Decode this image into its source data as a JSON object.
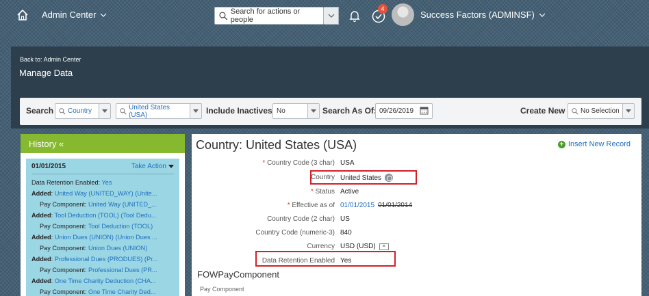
{
  "shell": {
    "app_title": "Admin Center",
    "search_placeholder": "Search for actions or people",
    "todo_count": "4",
    "user_name": "Success Factors (ADMINSF)"
  },
  "header": {
    "back_link": "Back to: Admin Center",
    "title": "Manage Data"
  },
  "filters": {
    "search_label": "Search",
    "object_type": "Country",
    "object_value": "United States (USA)",
    "include_inactives_label": "Include Inactives:",
    "include_inactives_value": "No",
    "search_as_of_label": "Search As Of:",
    "search_as_of_value": "09/26/2019",
    "create_new_label": "Create New",
    "create_new_value": "No Selection"
  },
  "history": {
    "title": "History «",
    "date": "01/01/2015",
    "take_action": "Take Action",
    "lines": [
      {
        "prefix": "Data Retention Enabled: ",
        "link": "Yes",
        "bold": false,
        "indent": false
      },
      {
        "prefix": "Added",
        "sep": ": ",
        "link": "United Way (UNITED_WAY) (Unite...",
        "bold": true,
        "indent": false
      },
      {
        "prefix": "Pay Component: ",
        "link": "United Way (UNITED_...",
        "bold": false,
        "indent": true
      },
      {
        "prefix": "Added",
        "sep": ": ",
        "link": "Tool Deduction (TOOL) (Tool Dedu...",
        "bold": true,
        "indent": false
      },
      {
        "prefix": "Pay Component: ",
        "link": "Tool Deduction (TOOL)",
        "bold": false,
        "indent": true
      },
      {
        "prefix": "Added",
        "sep": ": ",
        "link": "Union Dues (UNION) (Union Dues ...",
        "bold": true,
        "indent": false
      },
      {
        "prefix": "Pay Component: ",
        "link": "Union Dues (UNION)",
        "bold": false,
        "indent": true
      },
      {
        "prefix": "Added",
        "sep": ": ",
        "link": "Professional Dues (PRODUES) (Pr...",
        "bold": true,
        "indent": false
      },
      {
        "prefix": "Pay Component: ",
        "link": "Professional Dues (PR...",
        "bold": false,
        "indent": true
      },
      {
        "prefix": "Added",
        "sep": ": ",
        "link": "One Time Charity Deduction (CHA...",
        "bold": true,
        "indent": false
      },
      {
        "prefix": "Pay Component: ",
        "link": "One Time Charity Ded...",
        "bold": false,
        "indent": true
      }
    ]
  },
  "record": {
    "title": "Country: United States (USA)",
    "insert_new": "Insert New Record",
    "fields": [
      {
        "label": "Country Code (3 char)",
        "required": true,
        "value": "USA"
      },
      {
        "label": "Country",
        "required": false,
        "value": "United States",
        "icon": "globe-icon"
      },
      {
        "label": "Status",
        "required": true,
        "value": "Active"
      },
      {
        "label": "Effective as of",
        "required": true,
        "value": "01/01/2015",
        "old": "01/01/2014"
      },
      {
        "label": "Country Code (2 char)",
        "required": false,
        "value": "US"
      },
      {
        "label": "Country Code (numeric-3)",
        "required": false,
        "value": "840"
      },
      {
        "label": "Currency",
        "required": false,
        "value": "USD (USD)",
        "icon": "currency-icon"
      },
      {
        "label": "Data Retention Enabled",
        "required": false,
        "value": "Yes"
      }
    ],
    "section_title": "FOWPayComponent",
    "section_sub": "Pay Component"
  },
  "colors": {
    "history_header": "#86b92f",
    "history_card": "#9bd6e4",
    "highlight": "#d31f26",
    "link": "#1e6fbf"
  }
}
